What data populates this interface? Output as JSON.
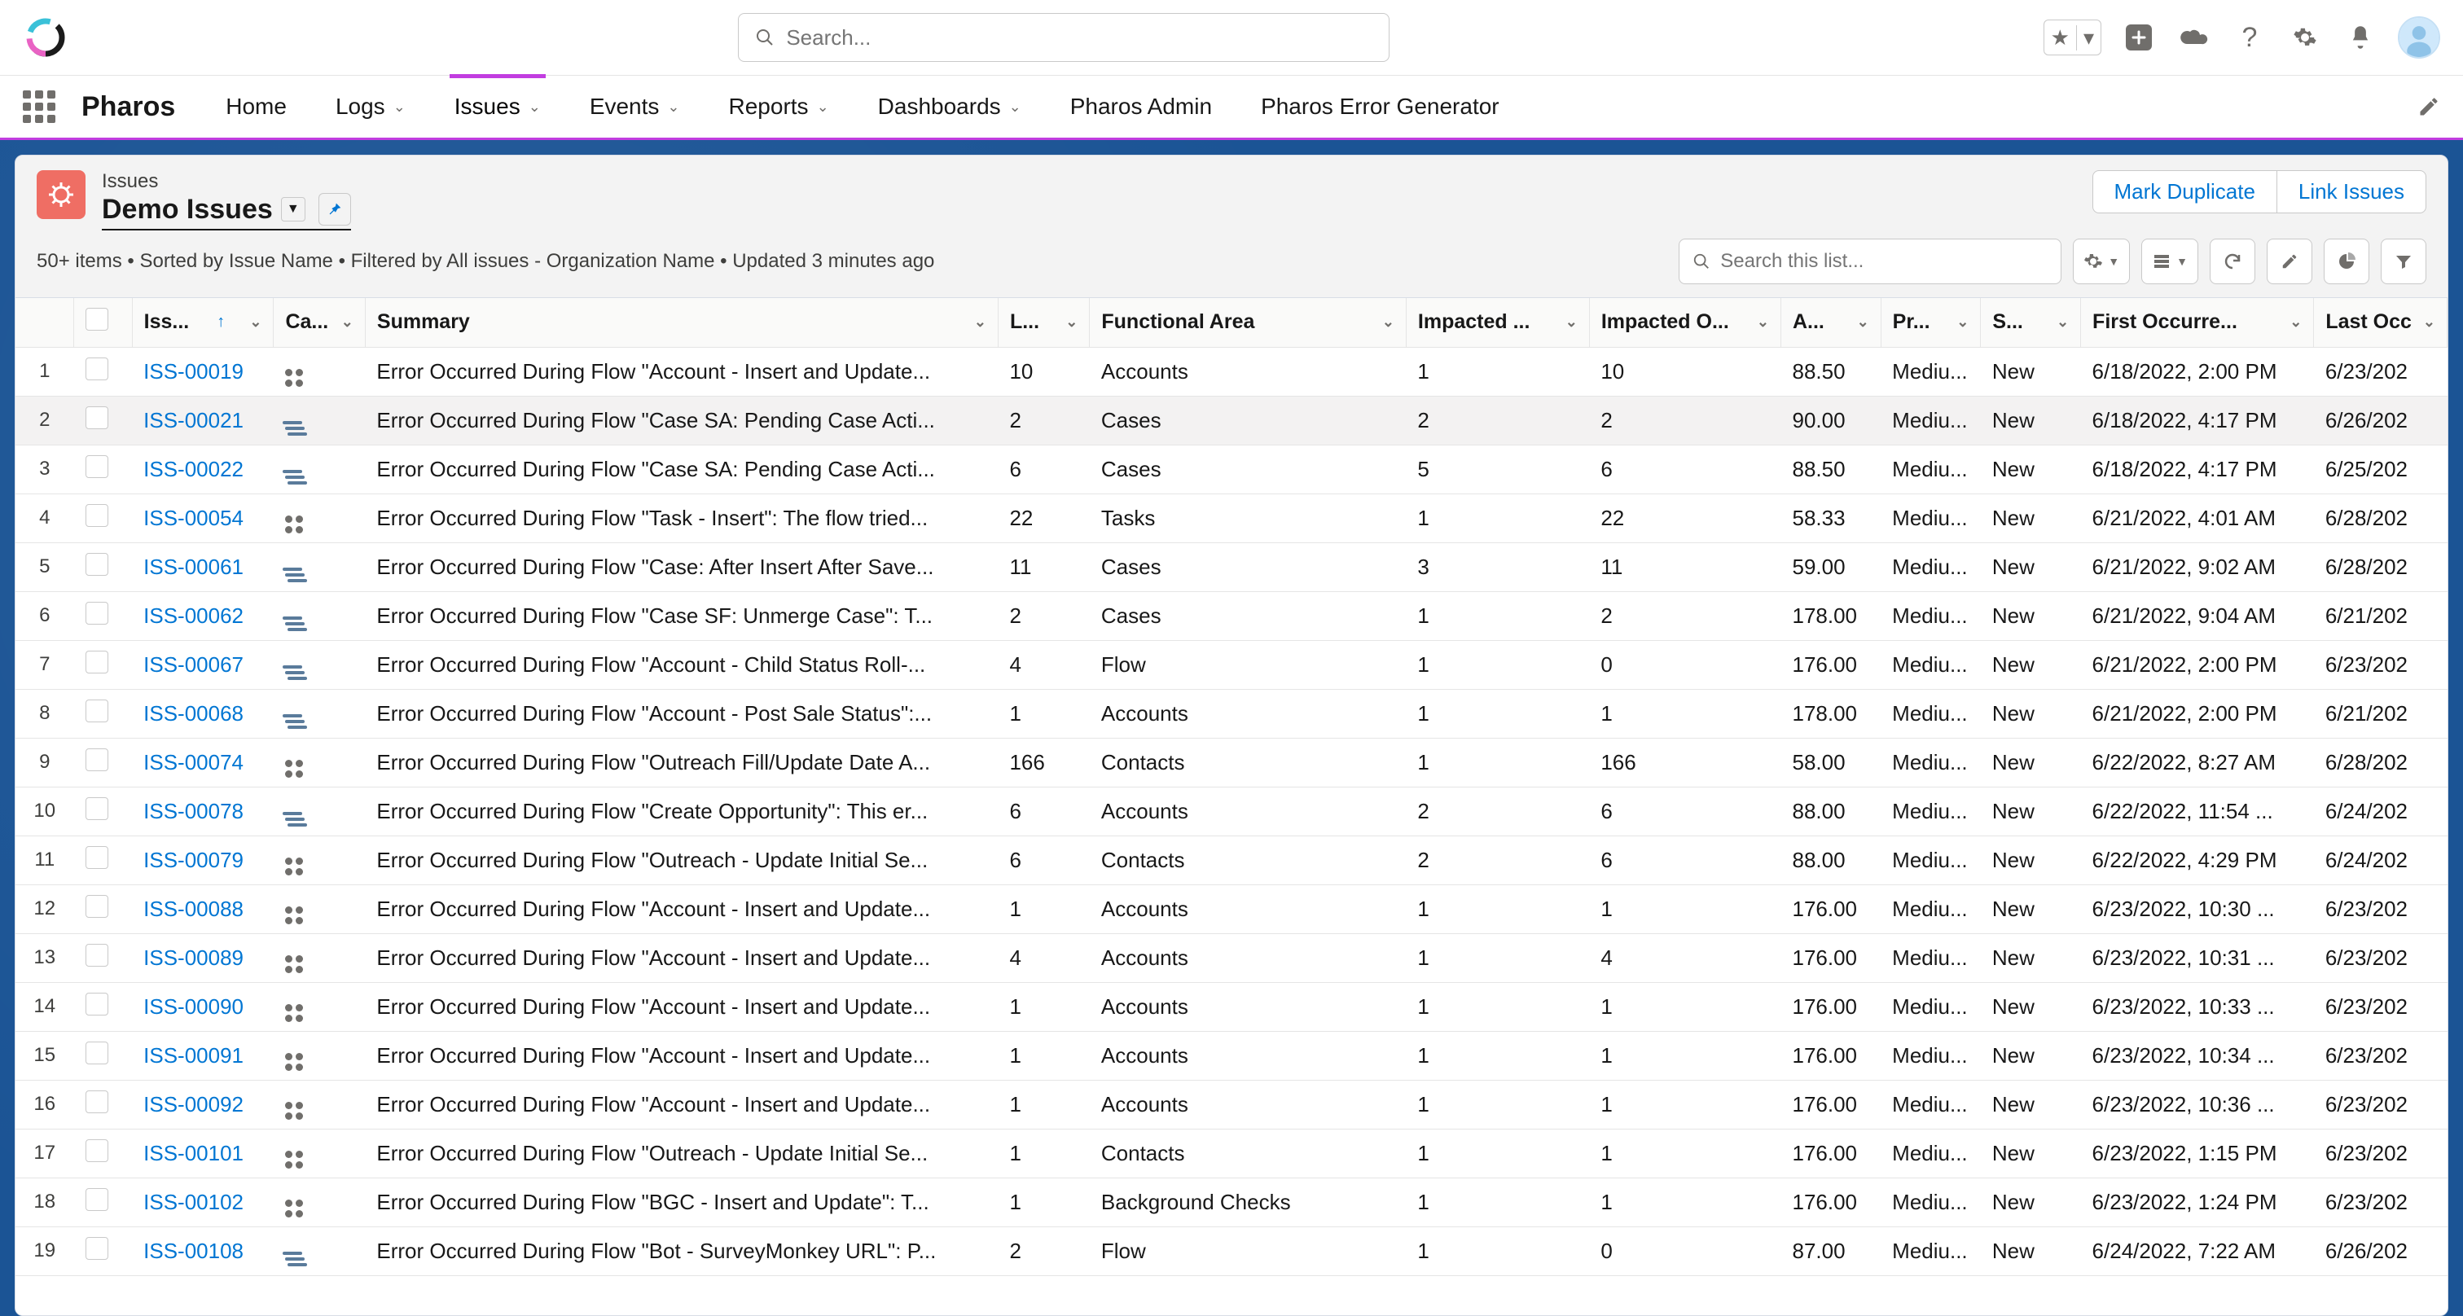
{
  "global": {
    "search_placeholder": "Search...",
    "app_name": "Pharos"
  },
  "nav": {
    "items": [
      {
        "label": "Home",
        "dd": false
      },
      {
        "label": "Logs",
        "dd": true
      },
      {
        "label": "Issues",
        "dd": true,
        "active": true
      },
      {
        "label": "Events",
        "dd": true
      },
      {
        "label": "Reports",
        "dd": true
      },
      {
        "label": "Dashboards",
        "dd": true
      },
      {
        "label": "Pharos Admin",
        "dd": false
      },
      {
        "label": "Pharos Error Generator",
        "dd": false
      }
    ]
  },
  "list": {
    "object_label": "Issues",
    "view_name": "Demo Issues",
    "meta": "50+ items • Sorted by Issue Name • Filtered by All issues - Organization Name • Updated 3 minutes ago",
    "actions": {
      "mark_duplicate": "Mark Duplicate",
      "link_issues": "Link Issues"
    },
    "search_placeholder": "Search this list..."
  },
  "columns": [
    "Iss...",
    "Ca...",
    "Summary",
    "L...",
    "Functional Area",
    "Impacted ...",
    "Impacted O...",
    "A...",
    "Pr...",
    "S...",
    "First Occurre...",
    "Last Occ"
  ],
  "rows": [
    {
      "n": "1",
      "iss": "ISS-00019",
      "cat": "dots",
      "sum": "Error Occurred During Flow \"Account - Insert and Update...",
      "l": "10",
      "fa": "Accounts",
      "iu": "1",
      "io": "10",
      "a": "88.50",
      "pr": "Mediu...",
      "st": "New",
      "fo": "6/18/2022, 2:00 PM",
      "lo": "6/23/202"
    },
    {
      "n": "2",
      "iss": "ISS-00021",
      "cat": "flow",
      "sum": "Error Occurred During Flow \"Case SA: Pending Case Acti...",
      "l": "2",
      "fa": "Cases",
      "iu": "2",
      "io": "2",
      "a": "90.00",
      "pr": "Mediu...",
      "st": "New",
      "fo": "6/18/2022, 4:17 PM",
      "lo": "6/26/202"
    },
    {
      "n": "3",
      "iss": "ISS-00022",
      "cat": "flow",
      "sum": "Error Occurred During Flow \"Case SA: Pending Case Acti...",
      "l": "6",
      "fa": "Cases",
      "iu": "5",
      "io": "6",
      "a": "88.50",
      "pr": "Mediu...",
      "st": "New",
      "fo": "6/18/2022, 4:17 PM",
      "lo": "6/25/202"
    },
    {
      "n": "4",
      "iss": "ISS-00054",
      "cat": "dots",
      "sum": "Error Occurred During Flow \"Task - Insert\": The flow tried...",
      "l": "22",
      "fa": "Tasks",
      "iu": "1",
      "io": "22",
      "a": "58.33",
      "pr": "Mediu...",
      "st": "New",
      "fo": "6/21/2022, 4:01 AM",
      "lo": "6/28/202"
    },
    {
      "n": "5",
      "iss": "ISS-00061",
      "cat": "flow",
      "sum": "Error Occurred During Flow \"Case: After Insert After Save...",
      "l": "11",
      "fa": "Cases",
      "iu": "3",
      "io": "11",
      "a": "59.00",
      "pr": "Mediu...",
      "st": "New",
      "fo": "6/21/2022, 9:02 AM",
      "lo": "6/28/202"
    },
    {
      "n": "6",
      "iss": "ISS-00062",
      "cat": "flow",
      "sum": "Error Occurred During Flow \"Case SF: Unmerge Case\": T...",
      "l": "2",
      "fa": "Cases",
      "iu": "1",
      "io": "2",
      "a": "178.00",
      "pr": "Mediu...",
      "st": "New",
      "fo": "6/21/2022, 9:04 AM",
      "lo": "6/21/202"
    },
    {
      "n": "7",
      "iss": "ISS-00067",
      "cat": "flow",
      "sum": "Error Occurred During Flow \"Account - Child Status Roll-...",
      "l": "4",
      "fa": "Flow",
      "iu": "1",
      "io": "0",
      "a": "176.00",
      "pr": "Mediu...",
      "st": "New",
      "fo": "6/21/2022, 2:00 PM",
      "lo": "6/23/202"
    },
    {
      "n": "8",
      "iss": "ISS-00068",
      "cat": "flow",
      "sum": "Error Occurred During Flow \"Account - Post Sale Status\":...",
      "l": "1",
      "fa": "Accounts",
      "iu": "1",
      "io": "1",
      "a": "178.00",
      "pr": "Mediu...",
      "st": "New",
      "fo": "6/21/2022, 2:00 PM",
      "lo": "6/21/202"
    },
    {
      "n": "9",
      "iss": "ISS-00074",
      "cat": "dots",
      "sum": "Error Occurred During Flow \"Outreach Fill/Update Date A...",
      "l": "166",
      "fa": "Contacts",
      "iu": "1",
      "io": "166",
      "a": "58.00",
      "pr": "Mediu...",
      "st": "New",
      "fo": "6/22/2022, 8:27 AM",
      "lo": "6/28/202"
    },
    {
      "n": "10",
      "iss": "ISS-00078",
      "cat": "flow",
      "sum": "Error Occurred During Flow \"Create Opportunity\": This er...",
      "l": "6",
      "fa": "Accounts",
      "iu": "2",
      "io": "6",
      "a": "88.00",
      "pr": "Mediu...",
      "st": "New",
      "fo": "6/22/2022, 11:54 ...",
      "lo": "6/24/202"
    },
    {
      "n": "11",
      "iss": "ISS-00079",
      "cat": "dots",
      "sum": "Error Occurred During Flow \"Outreach - Update Initial Se...",
      "l": "6",
      "fa": "Contacts",
      "iu": "2",
      "io": "6",
      "a": "88.00",
      "pr": "Mediu...",
      "st": "New",
      "fo": "6/22/2022, 4:29 PM",
      "lo": "6/24/202"
    },
    {
      "n": "12",
      "iss": "ISS-00088",
      "cat": "dots",
      "sum": "Error Occurred During Flow \"Account - Insert and Update...",
      "l": "1",
      "fa": "Accounts",
      "iu": "1",
      "io": "1",
      "a": "176.00",
      "pr": "Mediu...",
      "st": "New",
      "fo": "6/23/2022, 10:30 ...",
      "lo": "6/23/202"
    },
    {
      "n": "13",
      "iss": "ISS-00089",
      "cat": "dots",
      "sum": "Error Occurred During Flow \"Account - Insert and Update...",
      "l": "4",
      "fa": "Accounts",
      "iu": "1",
      "io": "4",
      "a": "176.00",
      "pr": "Mediu...",
      "st": "New",
      "fo": "6/23/2022, 10:31 ...",
      "lo": "6/23/202"
    },
    {
      "n": "14",
      "iss": "ISS-00090",
      "cat": "dots",
      "sum": "Error Occurred During Flow \"Account - Insert and Update...",
      "l": "1",
      "fa": "Accounts",
      "iu": "1",
      "io": "1",
      "a": "176.00",
      "pr": "Mediu...",
      "st": "New",
      "fo": "6/23/2022, 10:33 ...",
      "lo": "6/23/202"
    },
    {
      "n": "15",
      "iss": "ISS-00091",
      "cat": "dots",
      "sum": "Error Occurred During Flow \"Account - Insert and Update...",
      "l": "1",
      "fa": "Accounts",
      "iu": "1",
      "io": "1",
      "a": "176.00",
      "pr": "Mediu...",
      "st": "New",
      "fo": "6/23/2022, 10:34 ...",
      "lo": "6/23/202"
    },
    {
      "n": "16",
      "iss": "ISS-00092",
      "cat": "dots",
      "sum": "Error Occurred During Flow \"Account - Insert and Update...",
      "l": "1",
      "fa": "Accounts",
      "iu": "1",
      "io": "1",
      "a": "176.00",
      "pr": "Mediu...",
      "st": "New",
      "fo": "6/23/2022, 10:36 ...",
      "lo": "6/23/202"
    },
    {
      "n": "17",
      "iss": "ISS-00101",
      "cat": "dots",
      "sum": "Error Occurred During Flow \"Outreach - Update Initial Se...",
      "l": "1",
      "fa": "Contacts",
      "iu": "1",
      "io": "1",
      "a": "176.00",
      "pr": "Mediu...",
      "st": "New",
      "fo": "6/23/2022, 1:15 PM",
      "lo": "6/23/202"
    },
    {
      "n": "18",
      "iss": "ISS-00102",
      "cat": "dots",
      "sum": "Error Occurred During Flow \"BGC - Insert and Update\": T...",
      "l": "1",
      "fa": "Background Checks",
      "iu": "1",
      "io": "1",
      "a": "176.00",
      "pr": "Mediu...",
      "st": "New",
      "fo": "6/23/2022, 1:24 PM",
      "lo": "6/23/202"
    },
    {
      "n": "19",
      "iss": "ISS-00108",
      "cat": "flow",
      "sum": "Error Occurred During Flow \"Bot - SurveyMonkey URL\": P...",
      "l": "2",
      "fa": "Flow",
      "iu": "1",
      "io": "0",
      "a": "87.00",
      "pr": "Mediu...",
      "st": "New",
      "fo": "6/24/2022, 7:22 AM",
      "lo": "6/26/202"
    }
  ]
}
